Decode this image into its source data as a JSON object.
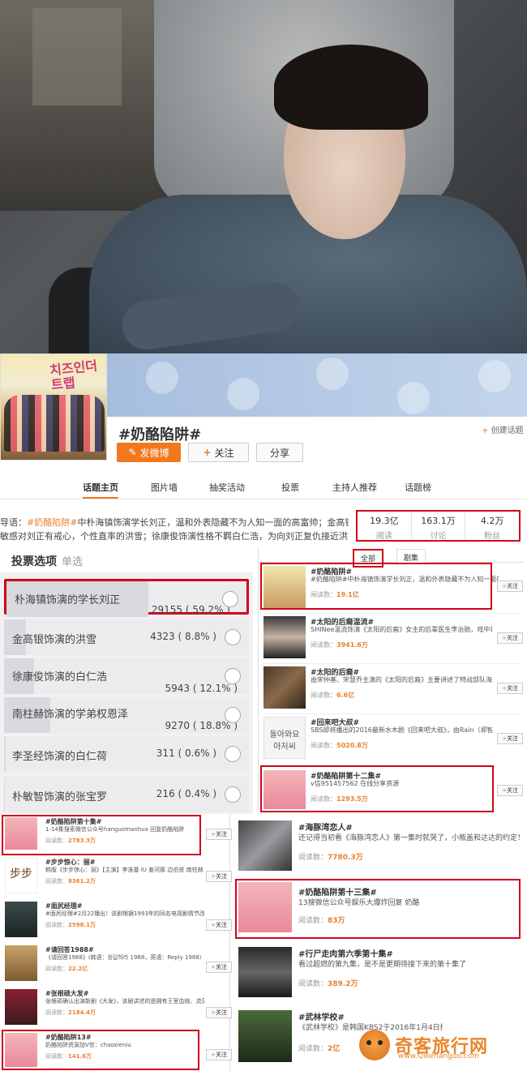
{
  "topic": {
    "title": "#奶酪陷阱#",
    "buttons": {
      "post": "发微博",
      "follow": "关注",
      "share": "分享"
    },
    "create_topic": "创建话题",
    "tabs": [
      "话题主页",
      "图片墙",
      "抽奖活动",
      "投票",
      "主持人推荐",
      "话题榜"
    ],
    "intro_line1_prefix": "导语：",
    "intro_line1_hl": "#奶酪陷阱#",
    "intro_line1_rest": "中朴海镇饰演学长刘正，温和外表隐藏不为人知一面的高富帅；金高银饰",
    "intro_line2": "敏感对刘正有戒心，个性直率的洪雪；徐康俊饰演性格不羁白仁浩，为向刘正复仇接近洪雪；",
    "stats": [
      {
        "num": "19.3亿",
        "label": "阅读"
      },
      {
        "num": "163.1万",
        "label": "讨论"
      },
      {
        "num": "4.2万",
        "label": "粉丝"
      }
    ]
  },
  "vote": {
    "title": "投票选项",
    "subtitle": "单选",
    "options": [
      {
        "name": "朴海镇饰演的学长刘正",
        "count": "29155 ( 59.2% )",
        "share": 0.592
      },
      {
        "name": "金高银饰演的洪雪",
        "count": "4323 ( 8.8% )",
        "share": 0.088
      },
      {
        "name": "徐康俊饰演的白仁浩",
        "count": "5943 ( 12.1% )",
        "share": 0.121
      },
      {
        "name": "南柱赫饰演的学弟权恩泽",
        "count": "9270 ( 18.8% )",
        "share": 0.188
      },
      {
        "name": "李圣经饰演的白仁荷",
        "count": "311 ( 0.6% )",
        "share": 0.006
      },
      {
        "name": "朴敏智饰演的张宝罗",
        "count": "216 ( 0.4% )",
        "share": 0.004
      }
    ]
  },
  "hot_list": {
    "tabs": [
      "全部",
      "剧集"
    ],
    "follow": "关注",
    "reads_label": "阅读数：",
    "items": [
      {
        "title": "#奶酪陷阱#",
        "desc": "#奶酪陷阱#中朴海镇饰演学长刘正，温和外表隐藏不为人知一面的高富帅...",
        "reads": "19.1亿"
      },
      {
        "title": "#太阳的后裔温流#",
        "desc": "SHINee温流饰演《太阳的后裔》女主的后辈医生李治勋，戏中将负责搞笑",
        "reads": "3941.6万"
      },
      {
        "title": "#太阳的后裔#",
        "desc": "由宋仲基、宋慧乔主演的《太阳的后裔》主要讲述了特战部队海外派兵组...",
        "reads": "6.6亿"
      },
      {
        "title": "#回来吧大叔#",
        "desc": "SBS即将播出的2016最新水木剧《回来吧大叔》，由Rain（郑智薰）、李瑛...",
        "reads": "5020.8万"
      },
      {
        "title": "#奶酪陷阱第十二集#",
        "desc": "v信951457562 在线分享资源",
        "reads": "1293.5万"
      }
    ]
  },
  "left_list": {
    "items": [
      {
        "title": "#奶酪陷阱第十集#",
        "desc": "1-14集搜索微信公众号hanguomanhua 回复奶酪陷阱",
        "reads": "2783.3万"
      },
      {
        "title": "#步步惊心：丽#",
        "desc": "韩版《步步惊心：丽》【主演】李准基 IU 姜河那 边伯贤 南柱赫 金世...",
        "reads": "8361.2万"
      },
      {
        "title": "#面尻经理#",
        "desc": "#面尻经理#2月22播出！该剧根据1993年的同名电视剧情节改编，讲述...",
        "reads": "2598.1万"
      },
      {
        "title": "#请回答1988#",
        "desc": "《请回答1988》(韩语：응답하라 1988，英语：Reply 1988）为韩国tvN2015...",
        "reads": "22.2亿"
      },
      {
        "title": "#张根硕大发#",
        "desc": "张根硕确认出演新剧《大发》，该剧讲述的是拥有王室血统、流落民间...",
        "reads": "2184.4万"
      },
      {
        "title": "#奶酪陷阱13#",
        "desc": "奶酪陷阱资源加V信：chaoxieniu",
        "reads": "141.6万"
      }
    ]
  },
  "right_list": {
    "items": [
      {
        "title": "#海豚湾恋人#",
        "desc": "还记得当初看《海豚湾恋人》第一集时就哭了，小瓶盖和达达的约定！",
        "reads": "7780.3万"
      },
      {
        "title": "#奶酪陷阱第十三集#",
        "desc": "13搜微信公众号娱乐大爆炸回复 奶酪",
        "reads": "83万"
      },
      {
        "title": "#行尸走肉第六季第十集#",
        "desc": "看过超燃的第九集，是不是更期待接下来的第十集了",
        "reads": "389.2万"
      },
      {
        "title": "#武林学校#",
        "desc": "《武林学校》是韩国KBS2于2016年1月4日播出的月火连续剧",
        "reads": "2亿"
      }
    ]
  },
  "watermark": {
    "name": "奇客旅行网",
    "url": "www.Qikehanguo.com"
  },
  "colors": {
    "accent": "#f2781e",
    "highlight": "#d0021b",
    "reads": "#e8812f"
  }
}
